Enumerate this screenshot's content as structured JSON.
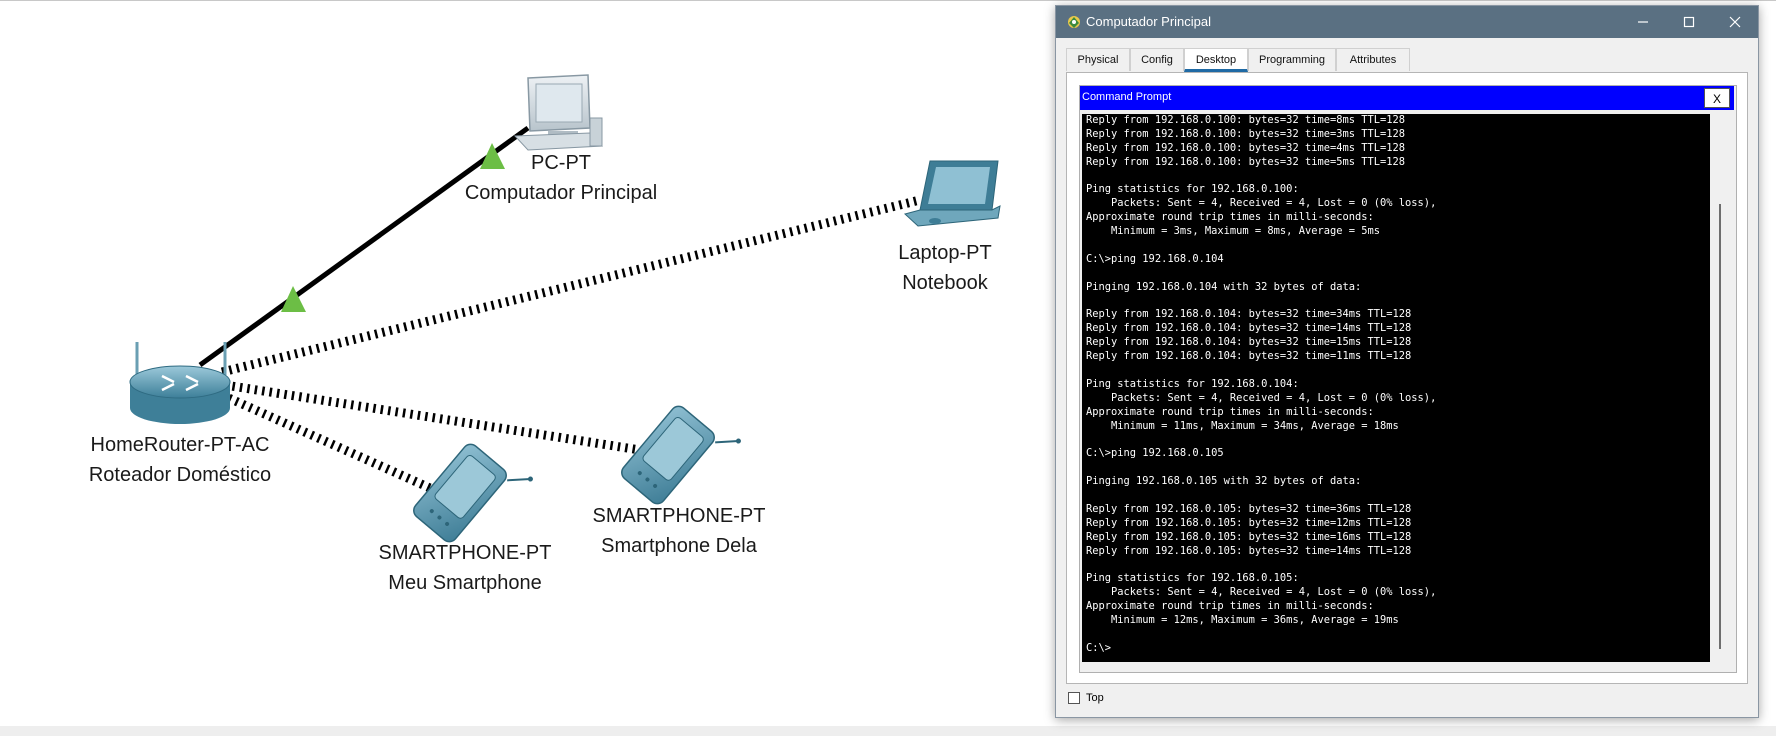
{
  "topology": {
    "devices": [
      {
        "id": "router",
        "model": "HomeRouter-PT-AC",
        "name": "Roteador Doméstico"
      },
      {
        "id": "pc",
        "model": "PC-PT",
        "name": "Computador Principal"
      },
      {
        "id": "laptop",
        "model": "Laptop-PT",
        "name": "Notebook"
      },
      {
        "id": "phone1",
        "model": "SMARTPHONE-PT",
        "name": "Meu Smartphone"
      },
      {
        "id": "phone2",
        "model": "SMARTPHONE-PT",
        "name": "Smartphone Dela"
      }
    ],
    "colors": {
      "link_up": "#6cbe45",
      "wired": "#000000",
      "wireless": "#000000",
      "device": "#4a8fa8"
    }
  },
  "window": {
    "title": "Computador Principal",
    "controls": {
      "minimize": "minimize-icon",
      "maximize": "maximize-icon",
      "close": "close-icon"
    },
    "tabs": [
      {
        "label": "Physical",
        "active": false
      },
      {
        "label": "Config",
        "active": false
      },
      {
        "label": "Desktop",
        "active": true
      },
      {
        "label": "Programming",
        "active": false
      },
      {
        "label": "Attributes",
        "active": false
      }
    ],
    "command_prompt": {
      "title": "Command Prompt",
      "close_label": "X",
      "lines": [
        "Reply from 192.168.0.100: bytes=32 time=8ms TTL=128",
        "Reply from 192.168.0.100: bytes=32 time=3ms TTL=128",
        "Reply from 192.168.0.100: bytes=32 time=4ms TTL=128",
        "Reply from 192.168.0.100: bytes=32 time=5ms TTL=128",
        "",
        "Ping statistics for 192.168.0.100:",
        "    Packets: Sent = 4, Received = 4, Lost = 0 (0% loss),",
        "Approximate round trip times in milli-seconds:",
        "    Minimum = 3ms, Maximum = 8ms, Average = 5ms",
        "",
        "C:\\>ping 192.168.0.104",
        "",
        "Pinging 192.168.0.104 with 32 bytes of data:",
        "",
        "Reply from 192.168.0.104: bytes=32 time=34ms TTL=128",
        "Reply from 192.168.0.104: bytes=32 time=14ms TTL=128",
        "Reply from 192.168.0.104: bytes=32 time=15ms TTL=128",
        "Reply from 192.168.0.104: bytes=32 time=11ms TTL=128",
        "",
        "Ping statistics for 192.168.0.104:",
        "    Packets: Sent = 4, Received = 4, Lost = 0 (0% loss),",
        "Approximate round trip times in milli-seconds:",
        "    Minimum = 11ms, Maximum = 34ms, Average = 18ms",
        "",
        "C:\\>ping 192.168.0.105",
        "",
        "Pinging 192.168.0.105 with 32 bytes of data:",
        "",
        "Reply from 192.168.0.105: bytes=32 time=36ms TTL=128",
        "Reply from 192.168.0.105: bytes=32 time=12ms TTL=128",
        "Reply from 192.168.0.105: bytes=32 time=16ms TTL=128",
        "Reply from 192.168.0.105: bytes=32 time=14ms TTL=128",
        "",
        "Ping statistics for 192.168.0.105:",
        "    Packets: Sent = 4, Received = 4, Lost = 0 (0% loss),",
        "Approximate round trip times in milli-seconds:",
        "    Minimum = 12ms, Maximum = 36ms, Average = 19ms",
        "",
        "C:\\>"
      ]
    },
    "top_checkbox": {
      "label": "Top",
      "checked": false
    }
  }
}
